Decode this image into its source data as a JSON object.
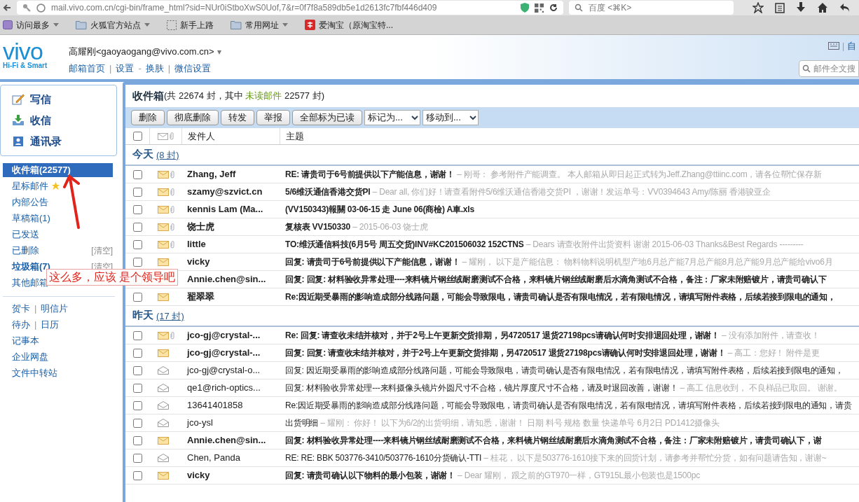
{
  "browser": {
    "url": "mail.vivo.com.cn/cgi-bin/frame_html?sid=NUr0iStboXwS0Uof,7&r=0f7f8a589db5e1d2613fc7fbf446d409",
    "search_placeholder": "百度 <⌘K>",
    "bookmarks": [
      {
        "label": "访问最多",
        "menu": true
      },
      {
        "label": "火狐官方站点",
        "menu": true
      },
      {
        "label": "新手上路",
        "menu": false
      },
      {
        "label": "常用网址",
        "menu": true
      },
      {
        "label": "爱淘宝（原淘宝特...",
        "menu": false
      }
    ]
  },
  "header": {
    "logo": "vivo",
    "tagline": "Hi-Fi & Smart",
    "user": "高耀刚<gaoyaogang@vivo.com.cn>",
    "user_menu": "▾",
    "links": [
      {
        "kind": "link",
        "text": "邮箱首页"
      },
      {
        "kind": "sep",
        "text": "|"
      },
      {
        "kind": "link",
        "text": "设置"
      },
      {
        "kind": "sep",
        "text": "-"
      },
      {
        "kind": "link",
        "text": "换肤"
      },
      {
        "kind": "sep",
        "text": "|"
      },
      {
        "kind": "link",
        "text": "微信设置"
      }
    ],
    "right_sep": "|",
    "right_link": "自",
    "search_placeholder": "邮件全文搜"
  },
  "sidebar": {
    "actions": [
      {
        "label": "写信"
      },
      {
        "label": "收信"
      },
      {
        "label": "通讯录"
      }
    ],
    "folders": [
      {
        "label": "收件箱(22577)",
        "selected": true,
        "bold": true,
        "starred": false
      },
      {
        "label": "星标邮件",
        "selected": false,
        "bold": false,
        "starred": true
      },
      {
        "label": "内部公告",
        "selected": false,
        "bold": false,
        "starred": false
      },
      {
        "label": "草稿箱(1)",
        "selected": false,
        "bold": false,
        "starred": false
      },
      {
        "label": "已发送",
        "selected": false,
        "bold": false,
        "starred": false
      },
      {
        "label": "已删除",
        "selected": false,
        "bold": false,
        "starred": false,
        "action": "[清空]"
      },
      {
        "label": "垃圾箱(7)",
        "selected": false,
        "bold": true,
        "starred": false,
        "action": "[清空]"
      },
      {
        "label": "其他邮箱",
        "selected": false,
        "bold": false,
        "starred": false
      }
    ],
    "tools": [
      [
        {
          "kind": "link",
          "text": "贺卡"
        },
        {
          "kind": "sep",
          "text": "|"
        },
        {
          "kind": "link",
          "text": "明信片"
        }
      ],
      [
        {
          "kind": "link",
          "text": "待办"
        },
        {
          "kind": "sep",
          "text": "|"
        },
        {
          "kind": "link",
          "text": "日历"
        }
      ],
      [
        {
          "kind": "link",
          "text": "记事本"
        }
      ],
      [
        {
          "kind": "link",
          "text": "企业网盘"
        }
      ],
      [
        {
          "kind": "link",
          "text": "文件中转站"
        }
      ]
    ]
  },
  "annotation": "这么多，应该 是个领导吧",
  "inbox": {
    "title": "收件箱",
    "summary_prefix": "(共 22674 封，其中 ",
    "unread_label": "未读邮件",
    "summary_suffix": " 22577 封)",
    "buttons": [
      "删除",
      "彻底删除",
      "转发",
      "举报",
      "全部标为已读"
    ],
    "dropdowns": [
      "标记为...",
      "移动到..."
    ],
    "select_all": {
      "checked": false
    },
    "columns": [
      "发件人",
      "主题"
    ],
    "groups": [
      {
        "label": "今天",
        "count": "(8 封)",
        "rows": [
          {
            "checked": false,
            "read": false,
            "attachment": true,
            "sender": "Zhang, Jeff",
            "subject": "RE: 请贵司于6号前提供以下产能信息，谢谢！",
            "preview": "– 刚哥： 参考附件产能调查。 本人邮箱从即日起正式转为Jeff.Zhang@ttiinc.com，请各位帮忙保存新"
          },
          {
            "checked": false,
            "read": false,
            "attachment": true,
            "sender": "szamy@szvict.cn",
            "subject": "5/6维沃通信香港交货PI",
            "preview": "– Dear all, 你们好！请查看附件5/6维沃通信香港交货PI ，谢谢！发运单号：VV0394643 Amy/陈丽 香港骏亚企"
          },
          {
            "checked": false,
            "read": false,
            "attachment": true,
            "sender": "kennis Lam (Ma...",
            "subject": "(VV150343)報關  03-06-15  走 June 06(商檢) A車.xls"
          },
          {
            "checked": false,
            "read": false,
            "attachment": true,
            "sender": "饶士虎",
            "subject": "复核表 VV150330",
            "preview": "– 2015-06-03 饶士虎"
          },
          {
            "checked": false,
            "read": false,
            "attachment": true,
            "sender": "little",
            "subject": "TO:维沃通信科技(6月5号 周五交货)INV#KC201506032 152CTNS",
            "preview": "– Dears 请查收附件出货资料 谢谢 2015-06-03 Thanks&Best Regards ---------"
          },
          {
            "checked": false,
            "read": false,
            "attachment": false,
            "sender": "vicky",
            "subject": "回复: 请贵司于6号前提供以下产能信息，谢谢！",
            "preview": "– 耀刚， 以下是产能信息： 物料物料说明机型产地6月总产能7月总产能8月总产能9月总产能给vivo6月"
          },
          {
            "checked": false,
            "read": false,
            "attachment": false,
            "sender": "Annie.chen@sin...",
            "subject": "回复: 回复: 材料验收异常处理----来料镜片钢丝绒耐磨测试不合格，来料镜片钢丝绒耐磨后水滴角测试不合格，备注：厂家未附赔镀片，请贵司确认下"
          },
          {
            "checked": false,
            "read": false,
            "attachment": false,
            "sender": "翟翠翠",
            "subject": "Re:因近期受暴雨的影响造成部分线路问题，可能会导致限电，请贵司确认是否有限电情况，若有限电情况，请填写附件表格，后续若接到限电的通知，"
          }
        ]
      },
      {
        "label": "昨天",
        "count": "(17 封)",
        "rows": [
          {
            "checked": false,
            "read": false,
            "attachment": true,
            "sender": "jco-gj@crystal-...",
            "subject": "Re: 回复: 请查收未结并核对，并于2号上午更新交货排期，另4720517 退货27198pcs请确认何时安排退回处理，谢谢！",
            "preview": "– 没有添加附件，请查收！"
          },
          {
            "checked": false,
            "read": false,
            "attachment": false,
            "sender": "jco-gj@crystal-...",
            "subject": "回复: 回复: 请查收未结并核对，并于2号上午更新交货排期，另4720517 退货27198pcs请确认何时安排退回处理，谢谢！",
            "preview": "– 高工：您好！ 附件是更"
          },
          {
            "checked": false,
            "read": true,
            "attachment": false,
            "sender": "jco-gj@crystal-o...",
            "subject": "回复: 因近期受暴雨的影响造成部分线路问题，可能会导致限电，请贵司确认是否有限电情况，若有限电情况，请填写附件表格，后续若接到限电的通知，"
          },
          {
            "checked": false,
            "read": true,
            "attachment": false,
            "sender": "qe1@rich-optics...",
            "subject": "回复: 材料验收异常处理---来料摄像头镜片外圆尺寸不合格，镜片厚度尺寸不合格，请及时退回改善，谢谢！",
            "preview": "– 高工 信息收到， 不良样品已取回。 谢谢。"
          },
          {
            "checked": false,
            "read": true,
            "attachment": false,
            "sender": "13641401858",
            "subject": "Re:因近期受暴雨的影响造成部分线路问题，可能会导致限电，请贵司确认是否有限电情况，若有限电情况，请填写附件表格，后续若接到限电的通知，请贵"
          },
          {
            "checked": false,
            "read": true,
            "attachment": false,
            "sender": "jco-ysl",
            "subject": "出货明细",
            "preview": "– 耀刚： 你好！ 以下为6/2的出货明细，请知悉，谢谢！ 日期 料号 规格 数量 快递单号 6月2日 PD1412摄像头"
          },
          {
            "checked": false,
            "read": false,
            "attachment": false,
            "sender": "Annie.chen@sin...",
            "subject": "回复: 材料验收异常处理----来料镜片钢丝绒耐磨测试不合格，来料镜片钢丝绒耐磨后水滴角测试不合格，备注：厂家未附赔镀片，请贵司确认下，谢"
          },
          {
            "checked": false,
            "read": true,
            "attachment": false,
            "sender": "Chen, Panda",
            "subject": "RE: RE: BBK 503776-3410/503776-1610分货确认-TTI",
            "preview": "– 桂花， 以下是503776-1610接下来的回货计划，请参考并帮忙分货，如有问题请告知，谢谢~"
          },
          {
            "checked": false,
            "read": false,
            "attachment": false,
            "sender": "vicky",
            "subject": "回复: 请贵司确认以下物料的最小包装，谢谢！",
            "preview": "– Dear 耀刚， 跟之前的GT970一样，GT915L最小包装也是1500pc"
          }
        ]
      }
    ]
  }
}
